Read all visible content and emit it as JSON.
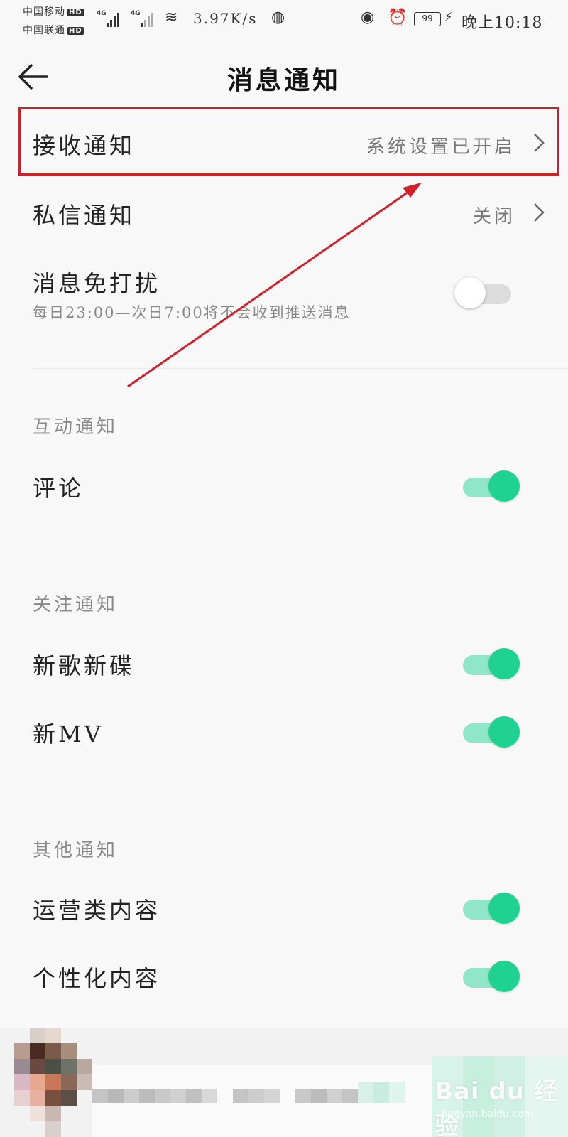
{
  "status_bar": {
    "carrier_1": "中国移动",
    "carrier_2": "中国联通",
    "hd_badge": "HD",
    "network_type": "4G",
    "speed": "3.97K/s",
    "battery": "99",
    "time": "晚上10:18"
  },
  "header": {
    "title": "消息通知"
  },
  "settings": {
    "receive": {
      "label": "接收通知",
      "value": "系统设置已开启"
    },
    "private_message": {
      "label": "私信通知",
      "value": "关闭"
    },
    "dnd": {
      "label": "消息免打扰",
      "description": "每日23:00—次日7:00将不会收到推送消息",
      "enabled": false
    }
  },
  "sections": {
    "interaction": {
      "title": "互动通知",
      "items": [
        {
          "label": "评论",
          "enabled": true
        }
      ]
    },
    "follow": {
      "title": "关注通知",
      "items": [
        {
          "label": "新歌新碟",
          "enabled": true
        },
        {
          "label": "新MV",
          "enabled": true
        }
      ]
    },
    "other": {
      "title": "其他通知",
      "items": [
        {
          "label": "运营类内容",
          "enabled": true
        },
        {
          "label": "个性化内容",
          "enabled": true
        }
      ]
    }
  },
  "watermark": {
    "text": "Bai du 经验",
    "sub": "jingyan.baidu.com"
  },
  "colors": {
    "accent": "#1fd291",
    "accent_track": "#8fe6c9",
    "annotation_red": "#d0202a"
  }
}
